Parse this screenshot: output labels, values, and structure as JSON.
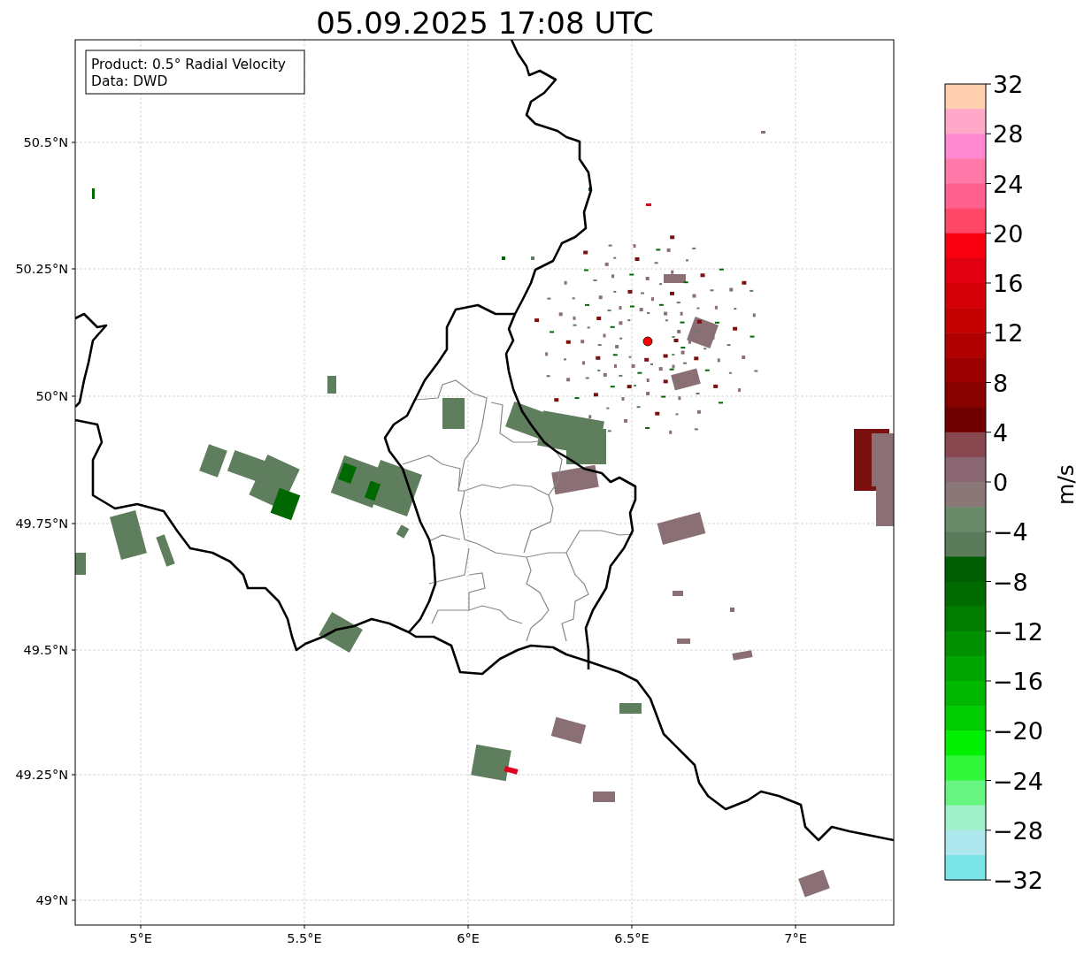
{
  "title": "05.09.2025 17:08 UTC",
  "info_box": [
    "Product: 0.5° Radial Velocity",
    "Data: DWD"
  ],
  "y_axis_ticks": [
    "50.5°N",
    "50.25°N",
    "50°N",
    "49.75°N",
    "49.5°N",
    "49.25°N",
    "49°N"
  ],
  "x_axis_ticks": [
    "5°E",
    "5.5°E",
    "6°E",
    "6.5°E",
    "7°E"
  ],
  "colorbar": {
    "label": "m/s",
    "ticks": [
      "32",
      "28",
      "24",
      "20",
      "16",
      "12",
      "8",
      "4",
      "0",
      "−4",
      "−8",
      "−12",
      "−16",
      "−20",
      "−24",
      "−28",
      "−32"
    ],
    "bands": [
      {
        "color": "#ffcfb0"
      },
      {
        "color": "#ffa8c8"
      },
      {
        "color": "#ff88d0"
      },
      {
        "color": "#ff78a8"
      },
      {
        "color": "#ff6090"
      },
      {
        "color": "#ff4868"
      },
      {
        "color": "#f80010"
      },
      {
        "color": "#e00010"
      },
      {
        "color": "#d40008"
      },
      {
        "color": "#c40000"
      },
      {
        "color": "#b00000"
      },
      {
        "color": "#9c0000"
      },
      {
        "color": "#880000"
      },
      {
        "color": "#700000"
      },
      {
        "color": "#884850"
      },
      {
        "color": "#8a6672"
      },
      {
        "color": "#8a7878"
      },
      {
        "color": "#6a8a6a"
      },
      {
        "color": "#5a7a5a"
      },
      {
        "color": "#005c00"
      },
      {
        "color": "#006c00"
      },
      {
        "color": "#007c00"
      },
      {
        "color": "#009000"
      },
      {
        "color": "#00a400"
      },
      {
        "color": "#00b800"
      },
      {
        "color": "#00cc00"
      },
      {
        "color": "#00f000"
      },
      {
        "color": "#30f838"
      },
      {
        "color": "#66f580"
      },
      {
        "color": "#a0f0cc"
      },
      {
        "color": "#aee8ee"
      },
      {
        "color": "#7ae4e8"
      }
    ]
  }
}
